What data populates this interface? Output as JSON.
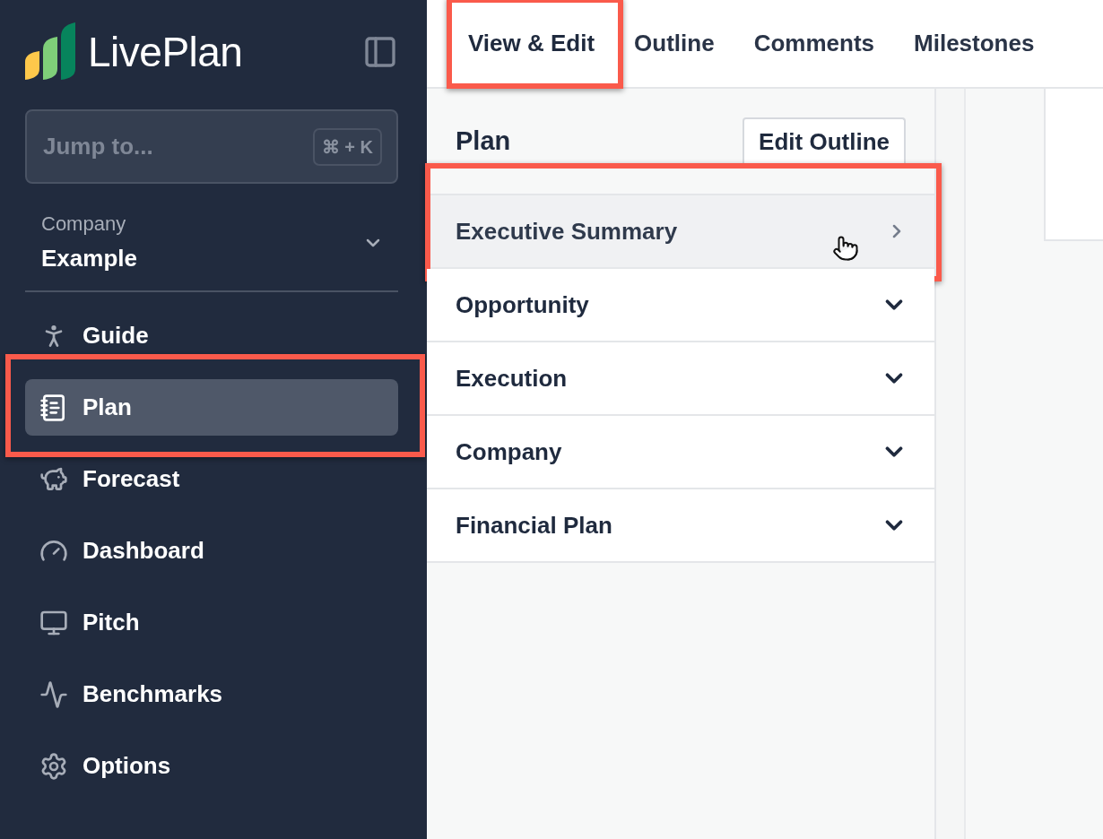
{
  "sidebar": {
    "logo": "LivePlan",
    "search": {
      "placeholder": "Jump to...",
      "shortcut": "⌘ + K"
    },
    "company": {
      "label": "Company",
      "value": "Example"
    },
    "items": [
      {
        "label": "Guide",
        "selected": false,
        "highlighted": false
      },
      {
        "label": "Plan",
        "selected": true,
        "highlighted": true
      },
      {
        "label": "Forecast",
        "selected": false,
        "highlighted": false
      },
      {
        "label": "Dashboard",
        "selected": false,
        "highlighted": false
      },
      {
        "label": "Pitch",
        "selected": false,
        "highlighted": false
      },
      {
        "label": "Benchmarks",
        "selected": false,
        "highlighted": false
      },
      {
        "label": "Options",
        "selected": false,
        "highlighted": false
      }
    ]
  },
  "tabs": [
    {
      "label": "View & Edit",
      "selected": true,
      "highlighted": true
    },
    {
      "label": "Outline",
      "selected": false,
      "highlighted": false
    },
    {
      "label": "Comments",
      "selected": false,
      "highlighted": false
    },
    {
      "label": "Milestones",
      "selected": false,
      "highlighted": false
    }
  ],
  "outline": {
    "title": "Plan",
    "edit_button": "Edit Outline",
    "items": [
      {
        "label": "Executive Summary",
        "kind": "page",
        "hovered": true,
        "highlighted": true
      },
      {
        "label": "Opportunity",
        "kind": "group",
        "hovered": false,
        "highlighted": false
      },
      {
        "label": "Execution",
        "kind": "group",
        "hovered": false,
        "highlighted": false
      },
      {
        "label": "Company",
        "kind": "group",
        "hovered": false,
        "highlighted": false
      },
      {
        "label": "Financial Plan",
        "kind": "group",
        "hovered": false,
        "highlighted": false
      }
    ]
  }
}
